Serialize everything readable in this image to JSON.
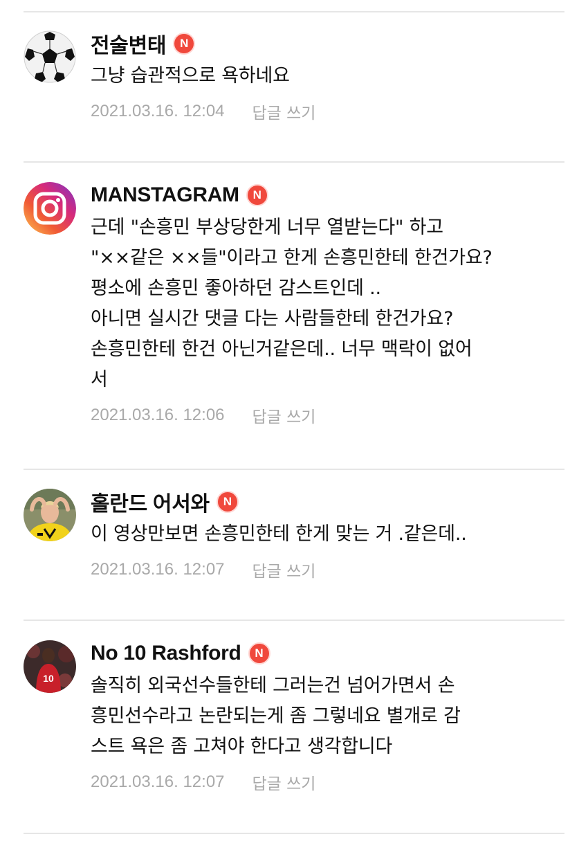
{
  "reply_label": "답글 쓰기",
  "badge_letter": "N",
  "colors": {
    "badge": "#f0483c",
    "meta_text": "#a9a9a9",
    "divider": "#e6e6e6"
  },
  "comments": [
    {
      "author": "전술변태",
      "avatar_icon": "soccer-ball-icon",
      "lines": [
        "그냥 습관적으로 욕하네요"
      ],
      "timestamp": "2021.03.16. 12:04"
    },
    {
      "author": "MANSTAGRAM",
      "avatar_icon": "instagram-logo-icon",
      "lines": [
        "근데 \"손흥민 부상당한게 너무 열받는다\" 하고",
        "\"××같은 ××들\"이라고 한게 손흥민한테 한건가요?",
        "평소에 손흥민 좋아하던 감스트인데 ..",
        "아니면 실시간 댓글 다는 사람들한테 한건가요?",
        "손흥민한테 한건 아닌거같은데.. 너무 맥락이 없어",
        "서"
      ],
      "timestamp": "2021.03.16. 12:06"
    },
    {
      "author": "홀란드 어서와",
      "avatar_icon": "player-photo-icon",
      "lines": [
        "이 영상만보면 손흥민한테 한게 맞는 거 .같은데.."
      ],
      "timestamp": "2021.03.16. 12:07"
    },
    {
      "author": "No 10 Rashford",
      "avatar_icon": "player-photo-icon",
      "lines": [
        "솔직히 외국선수들한테 그러는건 넘어가면서 손",
        "흥민선수라고 논란되는게 좀 그렇네요 별개로 감",
        "스트 욕은 좀 고쳐야 한다고 생각합니다"
      ],
      "timestamp": "2021.03.16. 12:07"
    }
  ]
}
